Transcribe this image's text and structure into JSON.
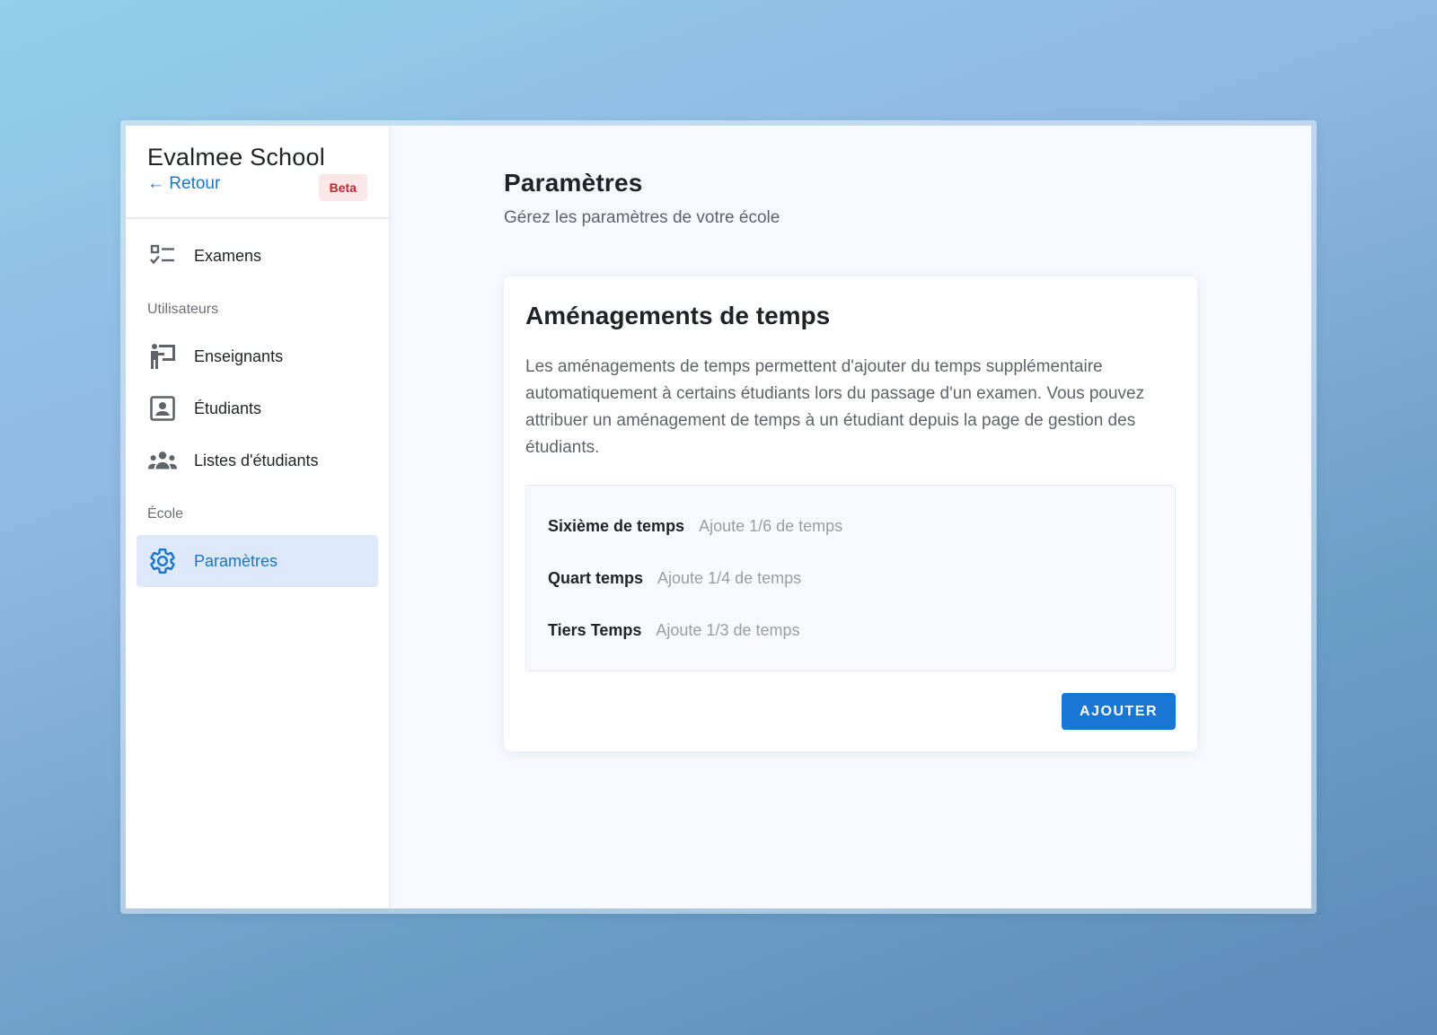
{
  "sidebar": {
    "brand_title": "Evalmee School",
    "back_label": "← Retour",
    "badge": "Beta",
    "items": [
      {
        "label": "Examens",
        "icon": "checklist-icon"
      },
      {
        "label": "Enseignants",
        "icon": "teacher-icon"
      },
      {
        "label": "Étudiants",
        "icon": "student-badge-icon"
      },
      {
        "label": "Listes d'étudiants",
        "icon": "groups-icon"
      },
      {
        "label": "Paramètres",
        "icon": "gear-icon",
        "active": true
      }
    ],
    "sections": {
      "users": "Utilisateurs",
      "school": "École"
    }
  },
  "main": {
    "title": "Paramètres",
    "subtitle": "Gérez les paramètres de votre école",
    "card": {
      "title": "Aménagements de temps",
      "description": "Les aménagements de temps permettent d'ajouter du temps supplémentaire automatiquement à certains étudiants lors du passage d'un examen. Vous pouvez attribuer un aménagement de temps à un étudiant depuis la page de gestion des étudiants.",
      "rows": [
        {
          "name": "Sixième de temps",
          "desc": "Ajoute 1/6 de temps"
        },
        {
          "name": "Quart temps",
          "desc": "Ajoute 1/4 de temps"
        },
        {
          "name": "Tiers Temps",
          "desc": "Ajoute 1/3 de temps"
        }
      ],
      "add_label": "AJOUTER"
    }
  },
  "colors": {
    "accent": "#1976d2",
    "active_bg": "#dde9fa",
    "badge_bg": "#fbe6e8",
    "badge_text": "#c3252f"
  }
}
